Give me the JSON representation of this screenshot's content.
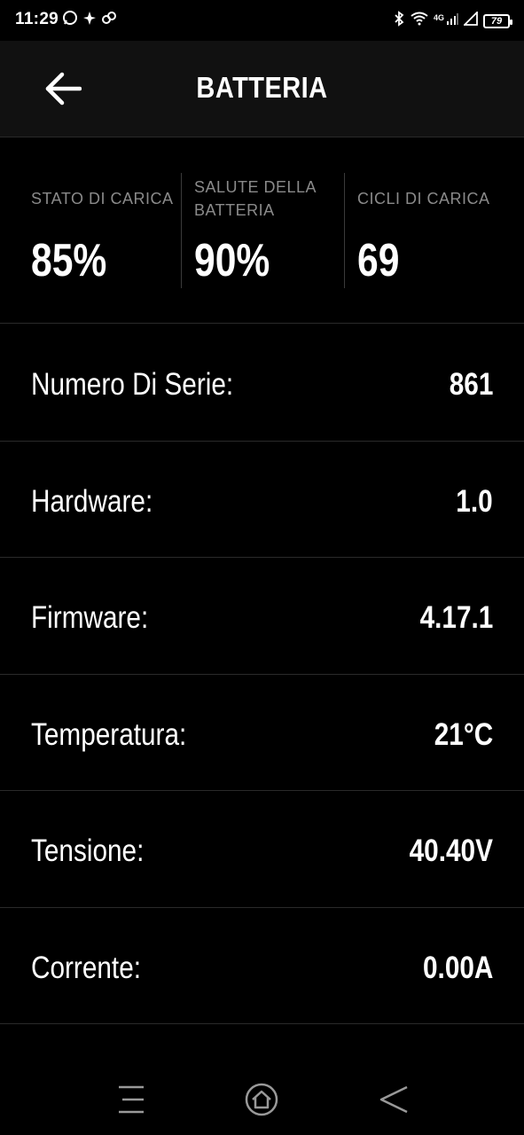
{
  "status_bar": {
    "time": "11:29",
    "battery": "79",
    "network": "4G",
    "icons": [
      "whatsapp-icon",
      "notification-icon",
      "link-icon",
      "bluetooth-icon",
      "wifi-icon",
      "signal-icon",
      "signal-icon-2",
      "battery-icon"
    ]
  },
  "header": {
    "title": "BATTERIA",
    "back_icon": "arrow-left-icon"
  },
  "stats": [
    {
      "label": "STATO DI CARICA",
      "value": "85%"
    },
    {
      "label": "SALUTE DELLA BATTERIA",
      "value": "90%"
    },
    {
      "label": "CICLI DI CARICA",
      "value": "69"
    }
  ],
  "info": [
    {
      "label": "Numero Di Serie:",
      "value": "861"
    },
    {
      "label": "Hardware:",
      "value": "1.0"
    },
    {
      "label": "Firmware:",
      "value": "4.17.1"
    },
    {
      "label": "Temperatura:",
      "value": "21°C"
    },
    {
      "label": "Tensione:",
      "value": "40.40V"
    },
    {
      "label": "Corrente:",
      "value": "0.00A"
    }
  ],
  "nav_bar": {
    "icons": [
      "menu-icon",
      "home-icon",
      "back-icon"
    ]
  },
  "colors": {
    "background": "#000000",
    "header_background": "#111111",
    "label_grey": "#8a8a8a",
    "divider": "#2a2a2a"
  }
}
